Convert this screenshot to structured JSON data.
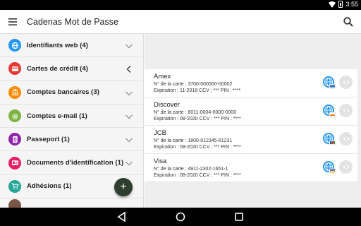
{
  "status_bar": {
    "time": "3:55"
  },
  "app_bar": {
    "title": "Cadenas Mot de Passe"
  },
  "categories": [
    {
      "label": "Identifiants web (4)",
      "icon": "globe-icon",
      "color": "#2196f3",
      "expanded": false
    },
    {
      "label": "Cartes de crédit (4)",
      "icon": "credit-card-icon",
      "color": "#e53935",
      "expanded": true
    },
    {
      "label": "Comptes bancaires (3)",
      "icon": "bank-icon",
      "color": "#fb8c00",
      "expanded": false
    },
    {
      "label": "Comptes e-mail (1)",
      "icon": "at-icon",
      "color": "#7cb342",
      "expanded": false
    },
    {
      "label": "Passeport (1)",
      "icon": "passport-icon",
      "color": "#8e24aa",
      "expanded": false
    },
    {
      "label": "Documents d'identification (1)",
      "icon": "id-card-icon",
      "color": "#e91e63",
      "expanded": false
    },
    {
      "label": "Adhésions (1)",
      "icon": "cart-icon",
      "color": "#26a69a",
      "expanded": false
    }
  ],
  "fab": {
    "label": "+"
  },
  "cards": [
    {
      "name": "Amex",
      "number": "N° de la carte : 3700-000000-00002",
      "expiration": "Expiration : 11-2018 CCV : *** PIN : ****",
      "brand_color": "#2e77bb"
    },
    {
      "name": "Discover",
      "number": "N° de la carte : 6011-0004-0000-0000",
      "expiration": "Expiration : 08-2020 CCV : *** PIN : ****",
      "brand_color": "#f08a24"
    },
    {
      "name": "JCB",
      "number": "N° de la carte : 1800-012345-61231",
      "expiration": "Expiration : 08-2020 CCV : *** PIN : ****",
      "brand_color": "#1f5aa6"
    },
    {
      "name": "Visa",
      "number": "N° de la carte : 4911-2302-1651-1",
      "expiration": "Expiration : 08-2020 CCV : *** PIN : ****",
      "brand_color": "#f7b600"
    }
  ]
}
